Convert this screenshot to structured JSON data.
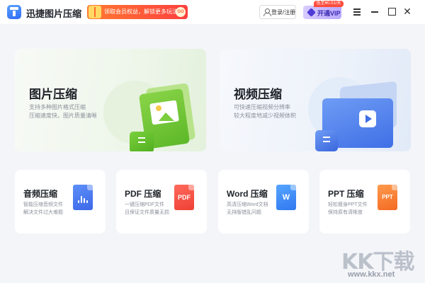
{
  "app": {
    "title": "迅捷图片压缩"
  },
  "header": {
    "promo_text": "领取会员权益，解锁更多玩法",
    "promo_go": "GO",
    "login_label": "登录/注册",
    "vip_label": "开通VIP",
    "vip_price_badge": "低至¥0.01/天"
  },
  "big_cards": [
    {
      "title": "图片压缩",
      "desc": [
        "支持多种图片格式压缩",
        "压缩速度快，图片质量清晰"
      ]
    },
    {
      "title": "视频压缩",
      "desc": [
        "可快速压缩视频分辨率",
        "较大程度地减少视频体积"
      ]
    }
  ],
  "small_cards": [
    {
      "title": "音频压缩",
      "desc": [
        "智能压缩音频文件",
        "解决文件过大难题"
      ],
      "icon": "audio-file-icon",
      "glyph": ""
    },
    {
      "title": "PDF 压缩",
      "desc": [
        "一键压缩PDF文件",
        "且保证文件质量无损"
      ],
      "icon": "pdf-file-icon",
      "glyph": "PDF"
    },
    {
      "title": "Word 压缩",
      "desc": [
        "高清压缩Word文档",
        "无排版错乱问题"
      ],
      "icon": "word-file-icon",
      "glyph": "W"
    },
    {
      "title": "PPT 压缩",
      "desc": [
        "轻松瘦身PPT文件",
        "保持原有清晰度"
      ],
      "icon": "ppt-file-icon",
      "glyph": "PPT"
    }
  ],
  "watermark": {
    "logo": "KK下载",
    "url": "www.kkx.net"
  },
  "colors": {
    "accent_green": "#5cb828",
    "accent_blue": "#3f6fe6",
    "promo_red": "#ff3f3f",
    "vip_purple": "#b9a8ff"
  }
}
